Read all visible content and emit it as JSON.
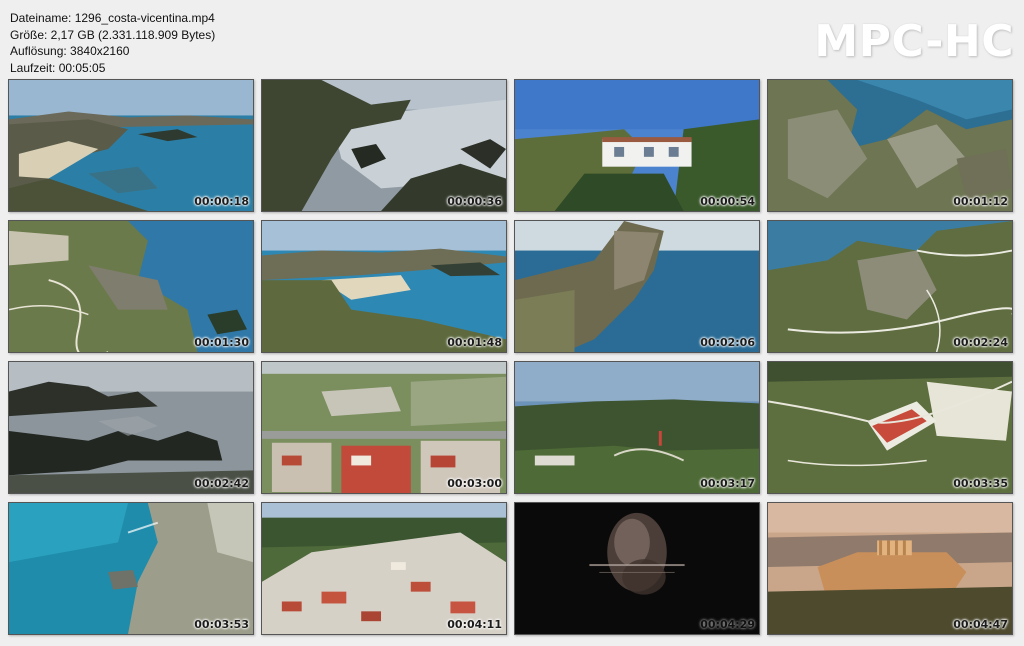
{
  "file_info": {
    "name": "Dateiname: 1296_costa-vicentina.mp4",
    "size": "Größe: 2,17 GB (2.331.118.909 Bytes)",
    "resolution": "Auflösung: 3840x2160",
    "duration": "Laufzeit: 00:05:05"
  },
  "brand": "MPC-HC",
  "thumbnails": [
    {
      "timestamp": "00:00:18",
      "scene": "coastal-beach"
    },
    {
      "timestamp": "00:00:36",
      "scene": "rocky-cove"
    },
    {
      "timestamp": "00:00:54",
      "scene": "white-house"
    },
    {
      "timestamp": "00:01:12",
      "scene": "rocky-coast-aerial"
    },
    {
      "timestamp": "00:01:30",
      "scene": "cliff-paths"
    },
    {
      "timestamp": "00:01:48",
      "scene": "coastal-beach"
    },
    {
      "timestamp": "00:02:06",
      "scene": "headland"
    },
    {
      "timestamp": "00:02:24",
      "scene": "cliff-paths"
    },
    {
      "timestamp": "00:02:42",
      "scene": "silhouette-rocks"
    },
    {
      "timestamp": "00:03:00",
      "scene": "town-aerial"
    },
    {
      "timestamp": "00:03:17",
      "scene": "hilltop"
    },
    {
      "timestamp": "00:03:35",
      "scene": "fort"
    },
    {
      "timestamp": "00:03:53",
      "scene": "turquoise-cliff"
    },
    {
      "timestamp": "00:04:11",
      "scene": "village"
    },
    {
      "timestamp": "00:04:29",
      "scene": "title-card"
    },
    {
      "timestamp": "00:04:47",
      "scene": "acropolis"
    }
  ]
}
